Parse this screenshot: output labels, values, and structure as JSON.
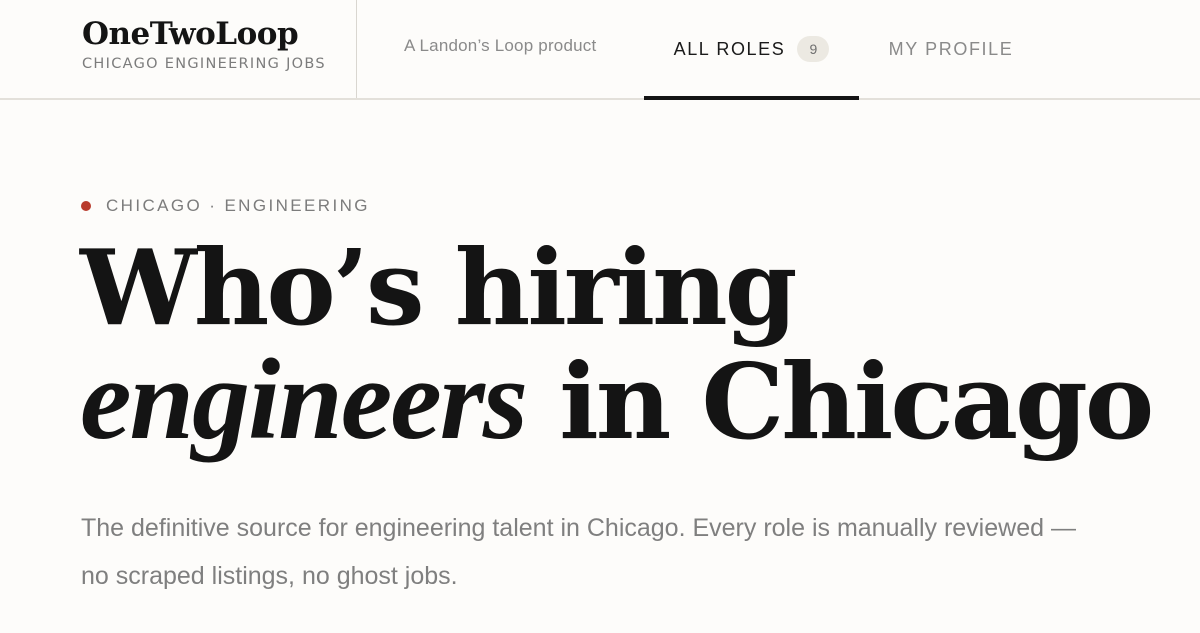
{
  "brand": {
    "name": "OneTwoLoop",
    "subtitle": "CHICAGO ENGINEERING JOBS"
  },
  "header": {
    "tagline": "A Landon’s Loop product",
    "tabs": [
      {
        "label": "ALL ROLES",
        "count": "9",
        "active": true
      },
      {
        "label": "MY PROFILE",
        "active": false
      }
    ]
  },
  "hero": {
    "eyebrow": "CHICAGO · ENGINEERING",
    "headline_line1": "Who’s hiring",
    "headline_italic": "engineers",
    "headline_rest": " in Chicago",
    "lede": "The definitive source for engineering talent in Chicago. Every role is manually reviewed — no scraped listings, no ghost jobs."
  },
  "colors": {
    "accent_dot": "#b83a2b",
    "text": "#141414",
    "muted": "#7f7f7f",
    "background": "#fdfcfa"
  }
}
